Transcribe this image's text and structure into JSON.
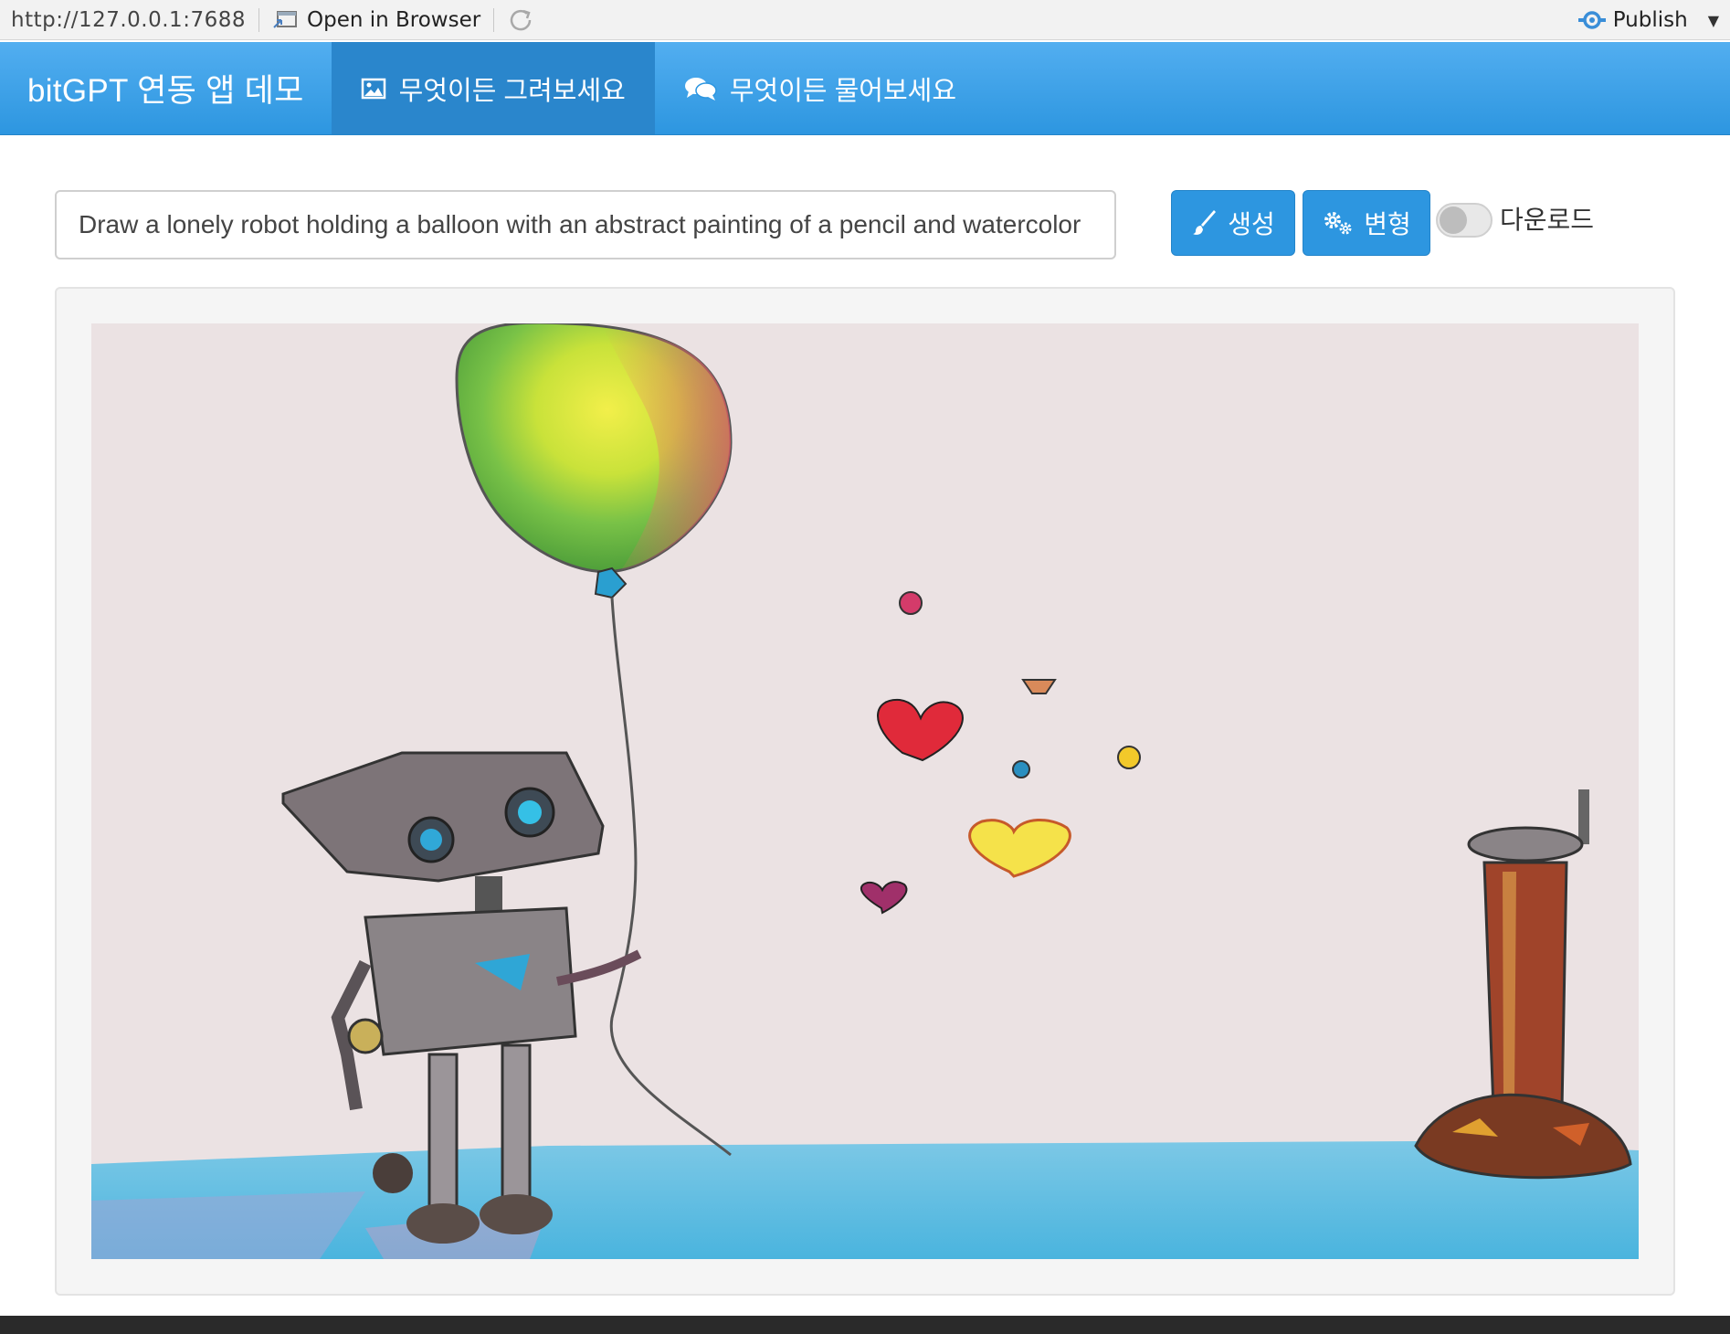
{
  "viewer": {
    "url": "http://127.0.0.1:7688",
    "open_in_browser": "Open in Browser",
    "publish": "Publish"
  },
  "navbar": {
    "brand": "bitGPT 연동 앱 데모",
    "tabs": [
      {
        "label": "무엇이든 그려보세요",
        "icon": "image-icon",
        "active": true
      },
      {
        "label": "무엇이든 물어보세요",
        "icon": "comments-icon",
        "active": false
      }
    ]
  },
  "controls": {
    "prompt_value": "Draw a lonely robot holding a balloon with an abstract painting of a pencil and watercolor",
    "generate_label": "생성",
    "variation_label": "변형",
    "download_label": "다운로드",
    "download_enabled": false
  },
  "colors": {
    "accent": "#2d96e0",
    "navbar_active": "#2a86cc",
    "panel_bg": "#f5f5f5"
  }
}
